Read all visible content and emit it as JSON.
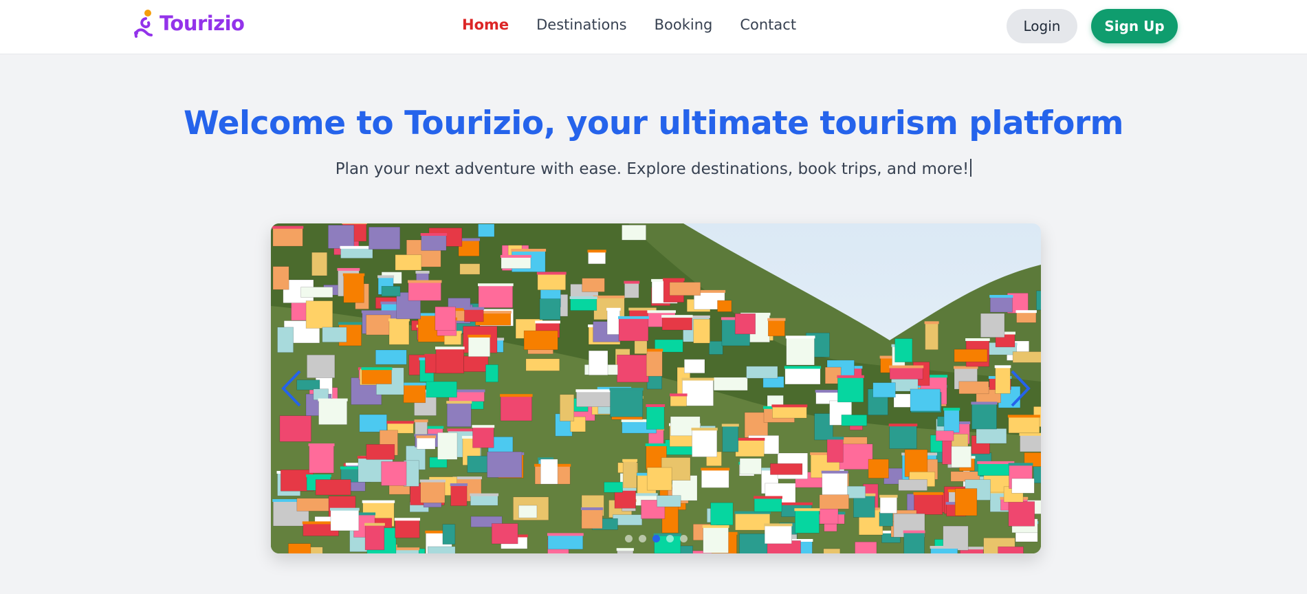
{
  "brand": {
    "name": "Tourizio",
    "color": "#9333ea",
    "icon": "traveler-icon"
  },
  "nav": {
    "links": [
      {
        "label": "Home",
        "active": true
      },
      {
        "label": "Destinations",
        "active": false
      },
      {
        "label": "Booking",
        "active": false
      },
      {
        "label": "Contact",
        "active": false
      }
    ],
    "active_color": "#dc2626"
  },
  "auth": {
    "login_label": "Login",
    "signup_label": "Sign Up",
    "signup_color": "#0f9d6e"
  },
  "hero": {
    "title": "Welcome to Tourizio, your ultimate tourism platform",
    "subtitle": "Plan your next adventure with ease. Explore destinations, book trips, and more!",
    "title_color": "#2563eb"
  },
  "carousel": {
    "prev_icon": "chevron-left-icon",
    "next_icon": "chevron-right-icon",
    "slide_count": 5,
    "active_slide": 3,
    "accent": "#2563eb"
  }
}
